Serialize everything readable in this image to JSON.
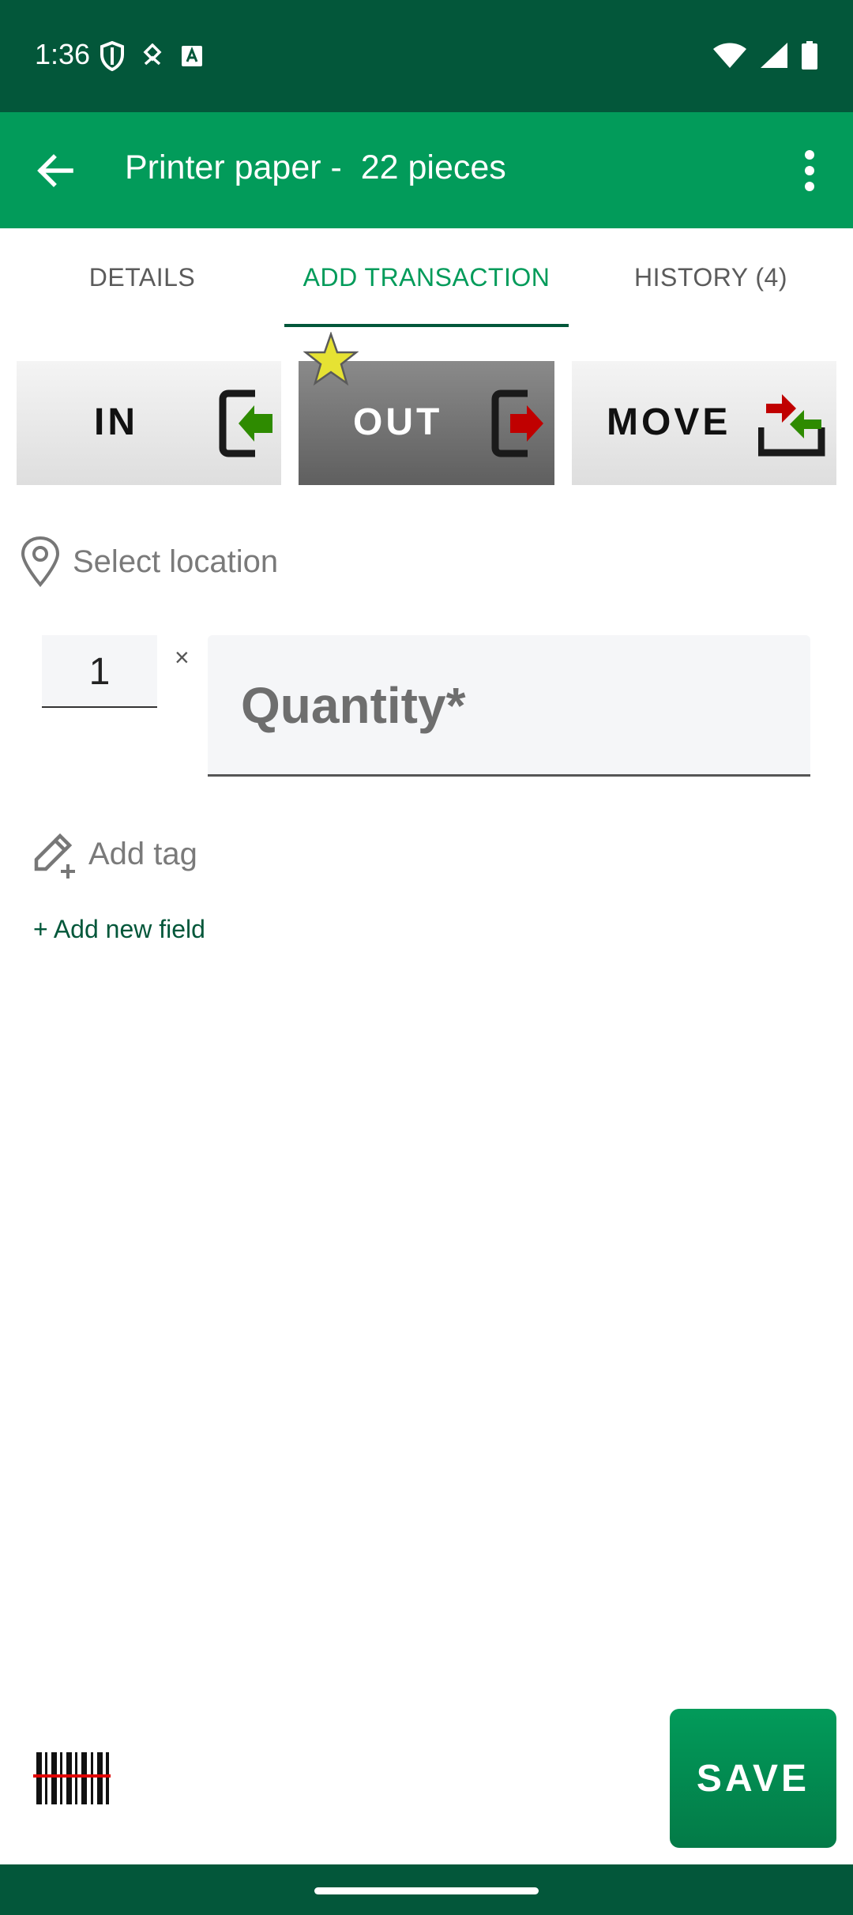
{
  "status_bar": {
    "time": "1:36",
    "left_icons": [
      "shield-icon",
      "data-saver-icon",
      "text-icon"
    ],
    "right_icons": [
      "wifi-icon",
      "signal-icon",
      "battery-icon"
    ]
  },
  "app_bar": {
    "title": "Printer paper -  22 pieces",
    "back_icon": "arrow-back-icon",
    "menu_icon": "more-vert-icon",
    "color": "#029b5a"
  },
  "tabs": [
    {
      "label": "DETAILS",
      "active": false
    },
    {
      "label": "ADD TRANSACTION",
      "active": true
    },
    {
      "label": "HISTORY (4)",
      "active": false
    }
  ],
  "transaction_types": [
    {
      "label": "IN",
      "icon": "check-in-icon",
      "selected": false
    },
    {
      "label": "OUT",
      "icon": "check-out-icon",
      "selected": true,
      "favorite": true
    },
    {
      "label": "MOVE",
      "icon": "move-icon",
      "selected": false
    }
  ],
  "location": {
    "label": "Select location",
    "icon": "location-pin-icon"
  },
  "quantity": {
    "multiplier": "1",
    "times_symbol": "×",
    "placeholder": "Quantity*"
  },
  "tag": {
    "label": "Add tag",
    "icon": "add-tag-icon"
  },
  "add_field": {
    "label": "+ Add new field"
  },
  "footer": {
    "save_label": "SAVE",
    "barcode_icon": "barcode-scan-icon"
  },
  "colors": {
    "primary_dark": "#03573a",
    "primary": "#029b5a",
    "in_arrow": "#2e8b00",
    "out_arrow": "#c00000",
    "favorite_star": "#e6e233"
  }
}
